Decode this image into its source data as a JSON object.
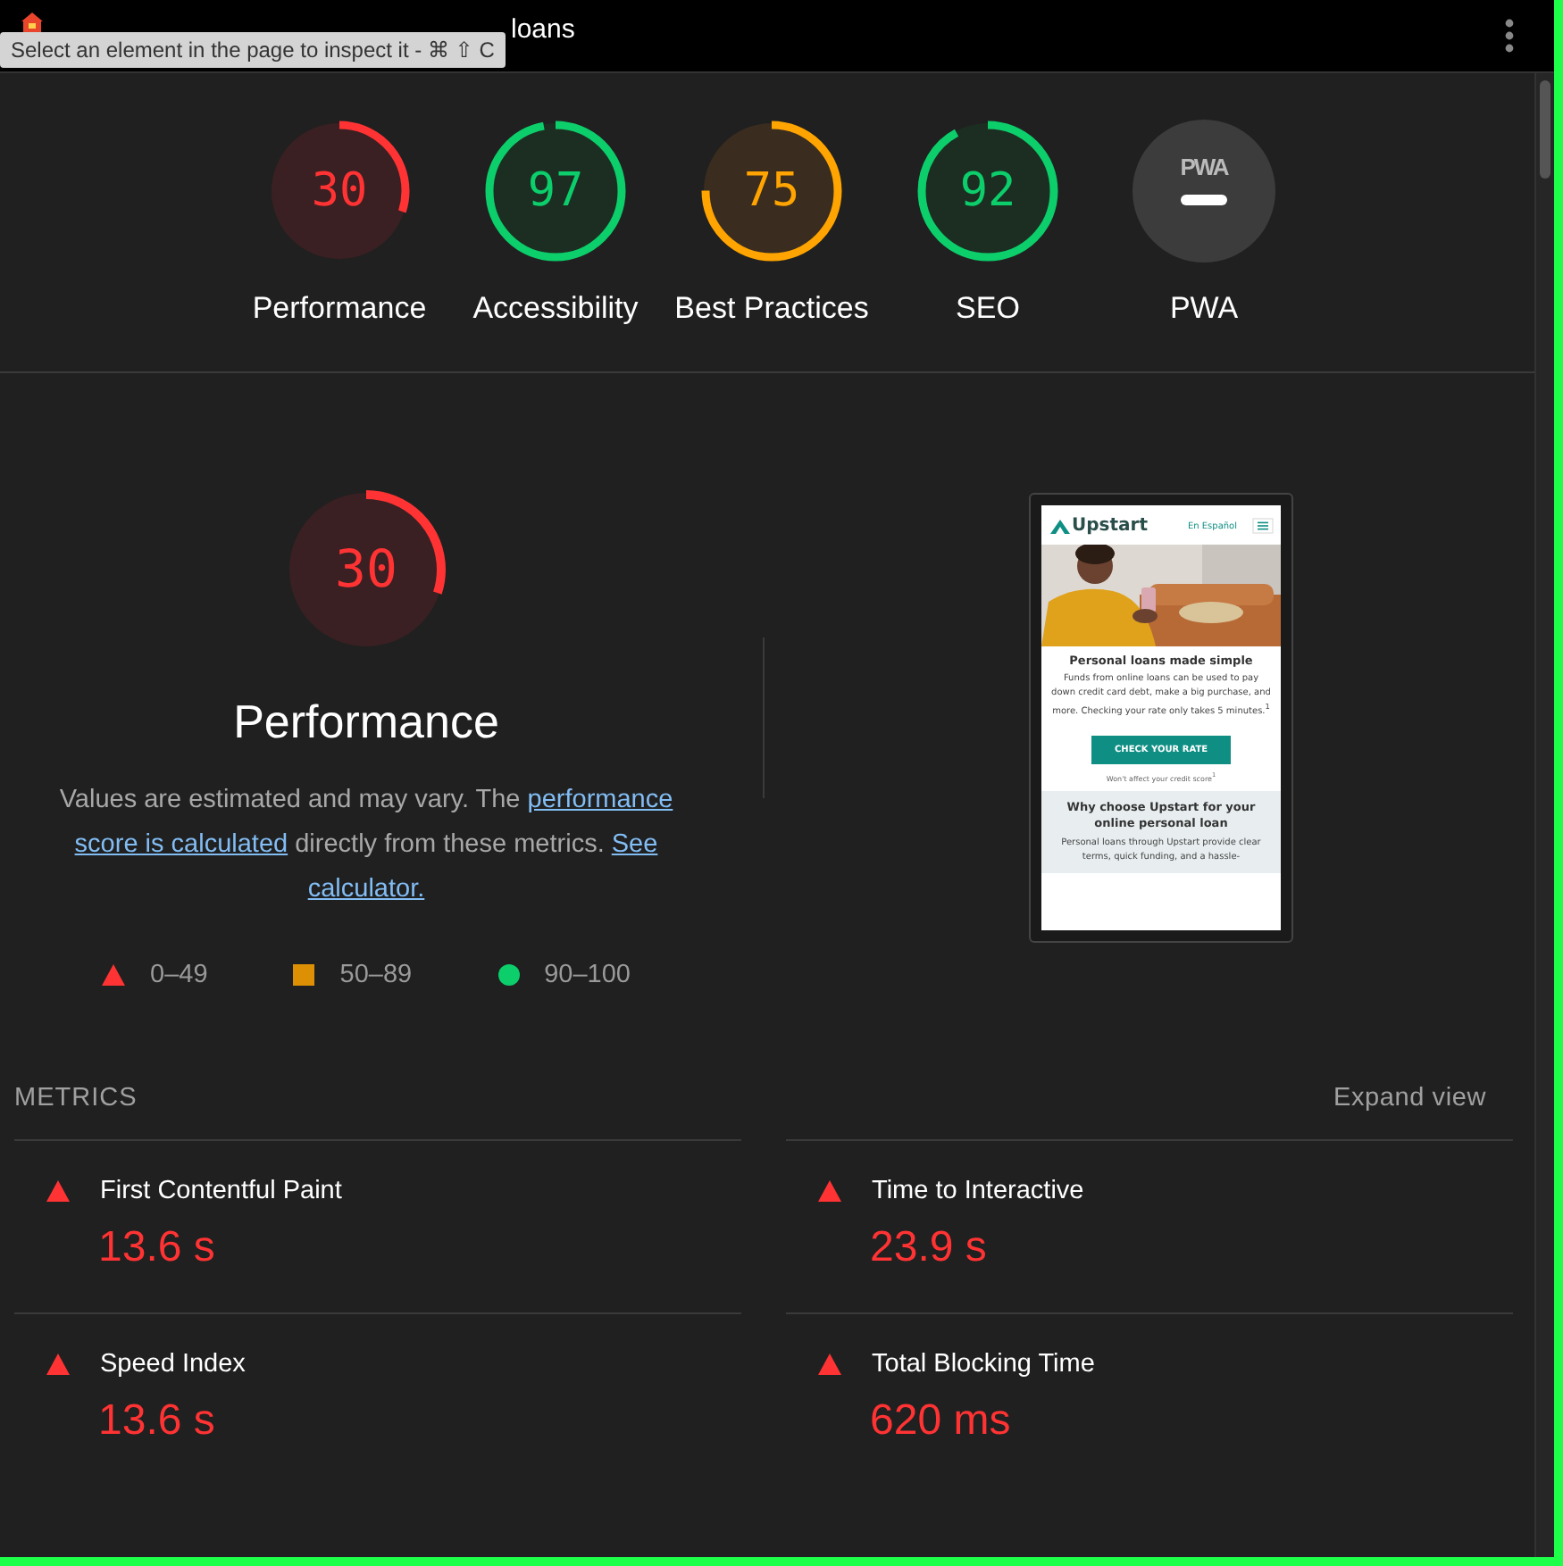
{
  "address_bar": {
    "url": "loans"
  },
  "tooltip": "Select an element in the page to inspect it - ⌘ ⇧ C",
  "gauges": [
    {
      "kind": "fail",
      "score": "30",
      "label": "Performance",
      "level": 0.3
    },
    {
      "kind": "pass",
      "score": "97",
      "label": "Accessibility",
      "level": 0.97
    },
    {
      "kind": "average",
      "score": "75",
      "label": "Best Practices",
      "level": 0.75
    },
    {
      "kind": "pass",
      "score": "92",
      "label": "SEO",
      "level": 0.92
    },
    {
      "kind": "pwa",
      "badge": "PWA",
      "label": "PWA"
    }
  ],
  "category": {
    "score": "30",
    "level": 0.3,
    "kind": "fail",
    "title": "Performance",
    "description": [
      {
        "kind": "text",
        "text": "Values are estimated and may vary. The "
      },
      {
        "kind": "link",
        "text": "performance score is calculated"
      },
      {
        "kind": "text",
        "text": " directly from these metrics. "
      },
      {
        "kind": "link",
        "text": "See calculator."
      }
    ],
    "legend": [
      {
        "kind": "triangle",
        "range": "0–49"
      },
      {
        "kind": "square",
        "range": "50–89"
      },
      {
        "kind": "circle",
        "range": "90–100"
      }
    ]
  },
  "screenshot": {
    "logo": "Upstart",
    "language_link": "En Español",
    "heading": "Personal loans made simple",
    "body": "Funds from online loans can be used to pay down credit card debt, make a big purchase, and more. Checking your rate only takes 5 minutes.$^{1}$",
    "button": "CHECK YOUR RATE",
    "note": "Won't affect your credit score$^{1}$",
    "section_heading": "Why choose Upstart for your online personal loan",
    "section_body": "Personal loans through Upstart provide clear terms, quick funding, and a hassle-"
  },
  "metrics": {
    "title": "METRICS",
    "toggle": "Expand view",
    "items": [
      {
        "name": "First Contentful Paint",
        "value": "13.6 s",
        "kind": "fail"
      },
      {
        "name": "Time to Interactive",
        "value": "23.9 s",
        "kind": "fail"
      },
      {
        "name": "Speed Index",
        "value": "13.6 s",
        "kind": "fail"
      },
      {
        "name": "Total Blocking Time",
        "value": "620 ms",
        "kind": "fail"
      }
    ]
  }
}
